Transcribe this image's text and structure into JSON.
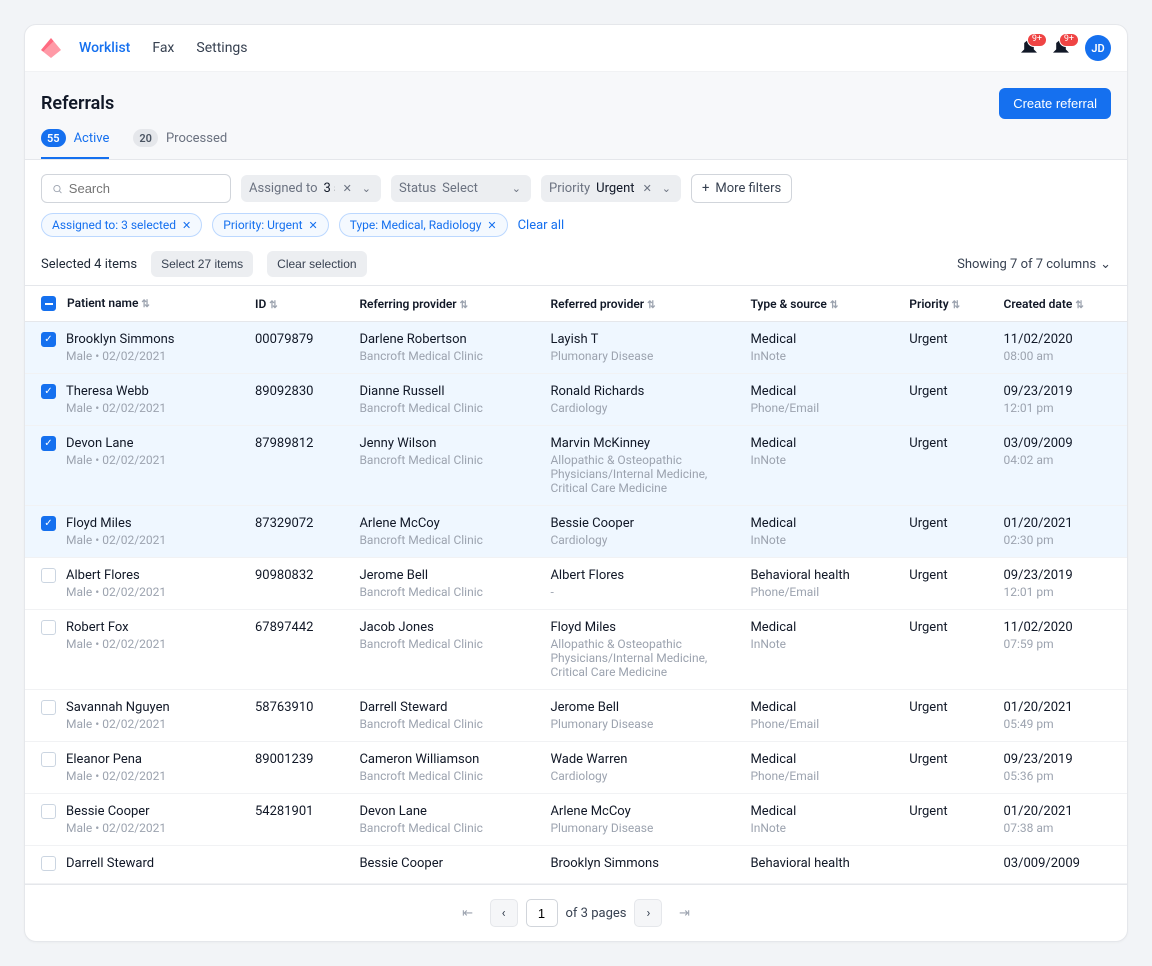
{
  "nav": {
    "worklist": "Worklist",
    "fax": "Fax",
    "settings": "Settings"
  },
  "notif_badge": "9+",
  "avatar_initials": "JD",
  "page_title": "Referrals",
  "create_button": "Create referral",
  "tabs": {
    "active": {
      "count": "55",
      "label": "Active"
    },
    "processed": {
      "count": "20",
      "label": "Processed"
    }
  },
  "search_placeholder": "Search",
  "filters": {
    "assigned": {
      "label": "Assigned to",
      "value": "3 selected"
    },
    "status": {
      "label": "Status",
      "value": "Select"
    },
    "priority": {
      "label": "Priority",
      "value": "Urgent"
    },
    "more": "More filters"
  },
  "chips": {
    "assigned": "Assigned to: 3 selected",
    "priority": "Priority: Urgent",
    "type": "Type: Medical, Radiology",
    "clear": "Clear all"
  },
  "selection": {
    "text": "Selected 4 items",
    "select_all": "Select 27 items",
    "clear": "Clear selection"
  },
  "columns_info": "Showing 7 of 7 columns",
  "headers": {
    "patient": "Patient name",
    "id": "ID",
    "referring": "Referring provider",
    "referred": "Referred provider",
    "type": "Type & source",
    "priority": "Priority",
    "created": "Created date"
  },
  "rows": [
    {
      "checked": true,
      "name": "Brooklyn Simmons",
      "meta": "Male  •  02/02/2021",
      "id": "00079879",
      "ref_name": "Darlene Robertson",
      "ref_sub": "Bancroft Medical Clinic",
      "refd_name": "Layish T",
      "refd_sub": "Plumonary Disease",
      "type": "Medical",
      "source": "InNote",
      "priority": "Urgent",
      "date": "11/02/2020",
      "time": "08:00 am"
    },
    {
      "checked": true,
      "name": "Theresa Webb",
      "meta": "Male  •  02/02/2021",
      "id": "89092830",
      "ref_name": "Dianne Russell",
      "ref_sub": "Bancroft Medical Clinic",
      "refd_name": "Ronald Richards",
      "refd_sub": "Cardiology",
      "type": "Medical",
      "source": "Phone/Email",
      "priority": "Urgent",
      "date": "09/23/2019",
      "time": "12:01 pm"
    },
    {
      "checked": true,
      "name": "Devon Lane",
      "meta": "Male  •  02/02/2021",
      "id": "87989812",
      "ref_name": "Jenny Wilson",
      "ref_sub": "Bancroft Medical Clinic",
      "refd_name": "Marvin McKinney",
      "refd_sub": "Allopathic & Osteopathic Physicians/Internal Medicine, Critical Care Medicine",
      "type": "Medical",
      "source": "InNote",
      "priority": "Urgent",
      "date": "03/09/2009",
      "time": "04:02 am"
    },
    {
      "checked": true,
      "name": "Floyd Miles",
      "meta": "Male  •  02/02/2021",
      "id": "87329072",
      "ref_name": "Arlene McCoy",
      "ref_sub": "Bancroft Medical Clinic",
      "refd_name": "Bessie Cooper",
      "refd_sub": "Cardiology",
      "type": "Medical",
      "source": "InNote",
      "priority": "Urgent",
      "date": "01/20/2021",
      "time": "02:30 pm"
    },
    {
      "checked": false,
      "name": "Albert Flores",
      "meta": "Male  •  02/02/2021",
      "id": "90980832",
      "ref_name": "Jerome Bell",
      "ref_sub": "Bancroft Medical Clinic",
      "refd_name": "Albert Flores",
      "refd_sub": "-",
      "type": "Behavioral health",
      "source": "Phone/Email",
      "priority": "Urgent",
      "date": "09/23/2019",
      "time": "12:01 pm"
    },
    {
      "checked": false,
      "name": "Robert Fox",
      "meta": "Male  •  02/02/2021",
      "id": "67897442",
      "ref_name": "Jacob Jones",
      "ref_sub": "Bancroft Medical Clinic",
      "refd_name": "Floyd Miles",
      "refd_sub": "Allopathic & Osteopathic Physicians/Internal Medicine, Critical Care Medicine",
      "type": "Medical",
      "source": "InNote",
      "priority": "Urgent",
      "date": "11/02/2020",
      "time": "07:59 pm"
    },
    {
      "checked": false,
      "name": "Savannah Nguyen",
      "meta": "Male  •  02/02/2021",
      "id": "58763910",
      "ref_name": "Darrell Steward",
      "ref_sub": "Bancroft Medical Clinic",
      "refd_name": "Jerome Bell",
      "refd_sub": "Plumonary Disease",
      "type": "Medical",
      "source": "Phone/Email",
      "priority": "Urgent",
      "date": "01/20/2021",
      "time": "05:49 pm"
    },
    {
      "checked": false,
      "name": "Eleanor Pena",
      "meta": "Male  •  02/02/2021",
      "id": "89001239",
      "ref_name": "Cameron Williamson",
      "ref_sub": "Bancroft Medical Clinic",
      "refd_name": "Wade Warren",
      "refd_sub": "Cardiology",
      "type": "Medical",
      "source": "Phone/Email",
      "priority": "Urgent",
      "date": "09/23/2019",
      "time": "05:36 pm"
    },
    {
      "checked": false,
      "name": "Bessie Cooper",
      "meta": "Male  •  02/02/2021",
      "id": "54281901",
      "ref_name": "Devon Lane",
      "ref_sub": "Bancroft Medical Clinic",
      "refd_name": "Arlene McCoy",
      "refd_sub": "Plumonary Disease",
      "type": "Medical",
      "source": "InNote",
      "priority": "Urgent",
      "date": "01/20/2021",
      "time": "07:38 am"
    },
    {
      "checked": false,
      "name": "Darrell Steward",
      "meta": "",
      "id": "",
      "ref_name": "Bessie Cooper",
      "ref_sub": "",
      "refd_name": "Brooklyn Simmons",
      "refd_sub": "",
      "type": "Behavioral health",
      "source": "",
      "priority": "",
      "date": "03/009/2009",
      "time": ""
    }
  ],
  "pagination": {
    "current": "1",
    "total_text": "of 3 pages"
  }
}
